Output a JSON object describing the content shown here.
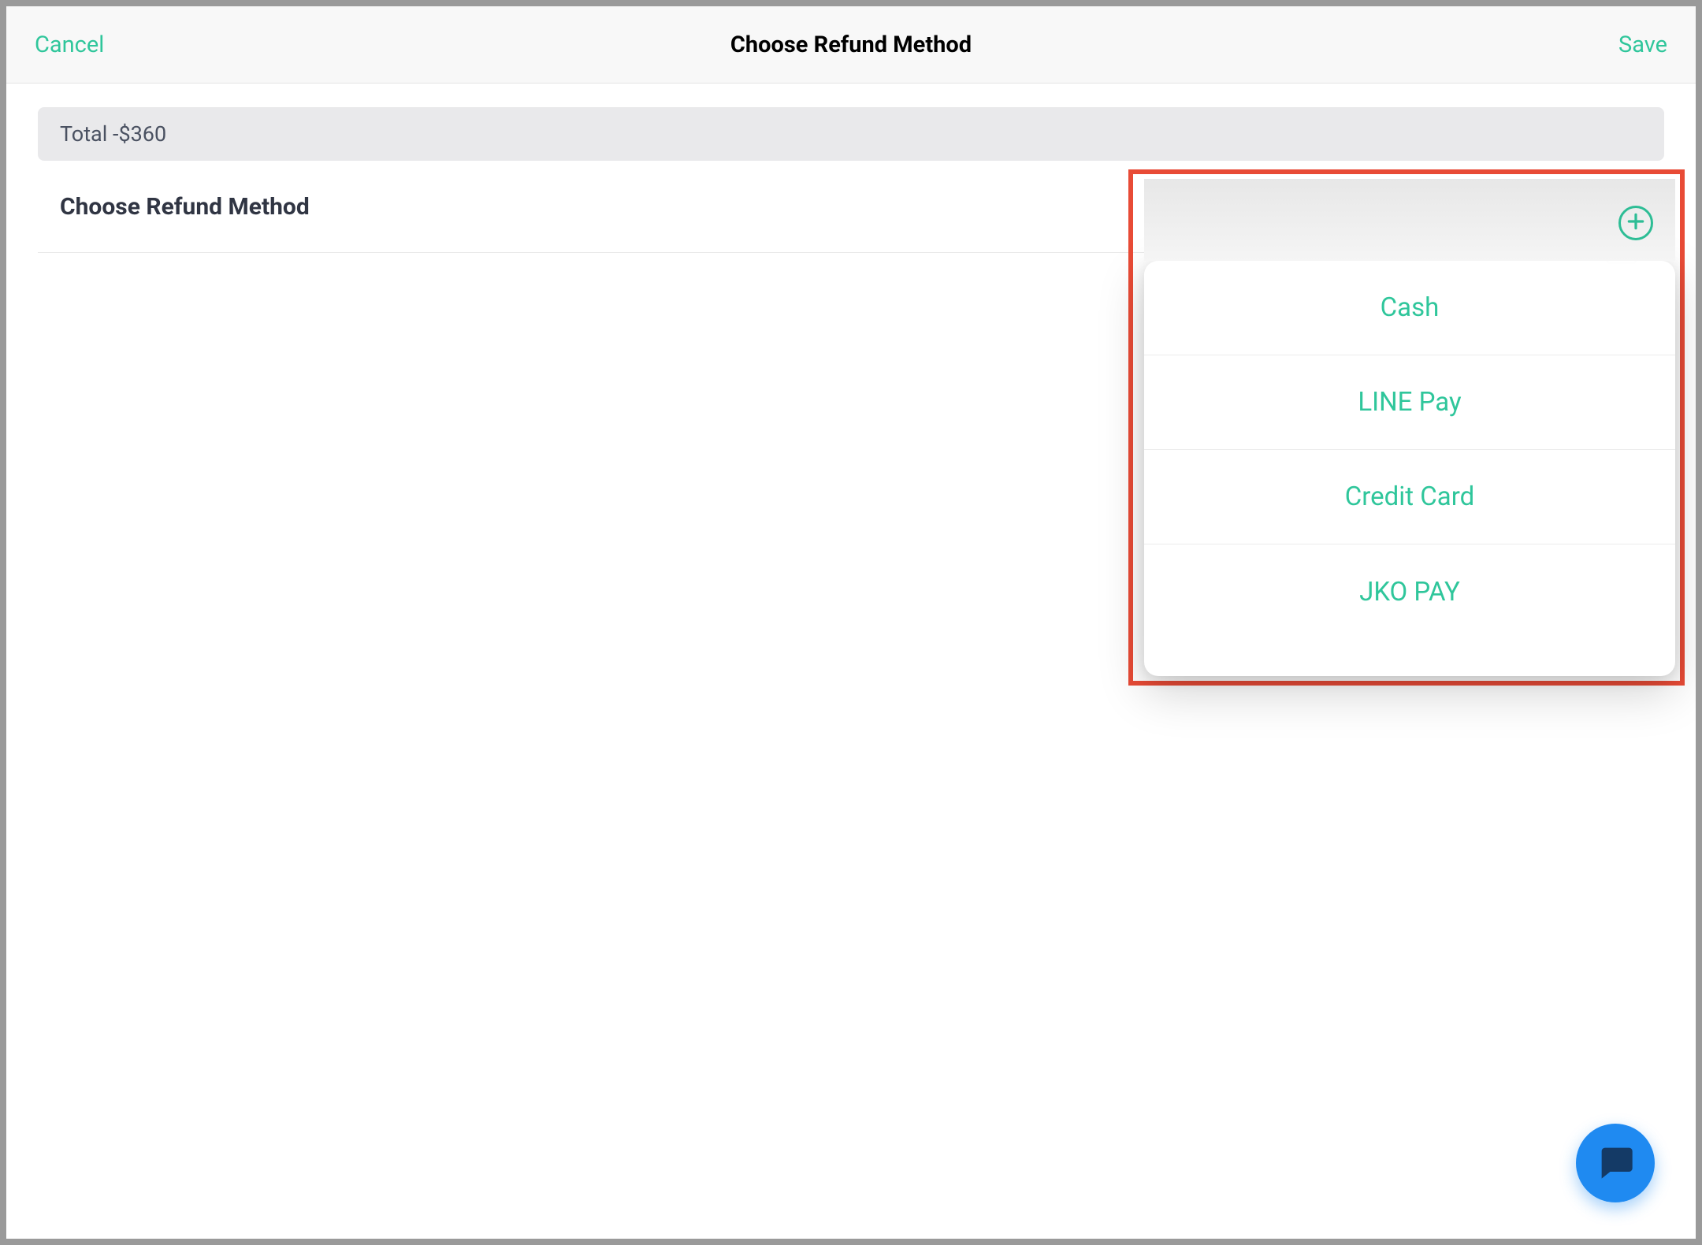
{
  "header": {
    "cancel_label": "Cancel",
    "title": "Choose Refund Method",
    "save_label": "Save"
  },
  "total_bar": {
    "text": "Total -$360"
  },
  "section": {
    "title": "Choose Refund Method"
  },
  "popover": {
    "options": [
      "Cash",
      "LINE Pay",
      "Credit Card",
      "JKO PAY"
    ]
  },
  "colors": {
    "accent": "#2fc69b",
    "highlight_border": "#e84b36",
    "fab": "#1f8af1"
  }
}
